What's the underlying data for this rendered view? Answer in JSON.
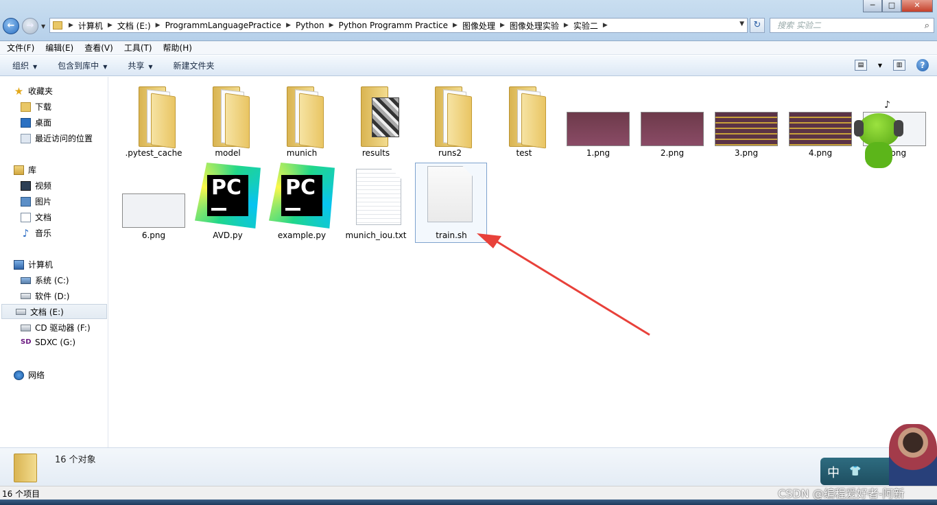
{
  "window": {
    "minimize_label": "─",
    "maximize_label": "□",
    "close_label": "✕"
  },
  "address": {
    "breadcrumbs": [
      "计算机",
      "文档 (E:)",
      "ProgrammLanguagePractice",
      "Python",
      "Python Programm Practice",
      "图像处理",
      "图像处理实验",
      "实验二"
    ]
  },
  "search": {
    "placeholder": "搜索 实验二"
  },
  "menu": [
    "文件(F)",
    "编辑(E)",
    "查看(V)",
    "工具(T)",
    "帮助(H)"
  ],
  "toolbar": [
    "组织",
    "包含到库中",
    "共享",
    "新建文件夹"
  ],
  "nav": {
    "favorites": "收藏夹",
    "downloads": "下载",
    "desktop": "桌面",
    "recent": "最近访问的位置",
    "libraries": "库",
    "videos": "视频",
    "pictures": "图片",
    "documents": "文档",
    "music": "音乐",
    "computer": "计算机",
    "drive_c": "系统 (C:)",
    "drive_d": "软件 (D:)",
    "drive_e": "文档 (E:)",
    "drive_f": "CD 驱动器 (F:)",
    "drive_g": "SDXC (G:)",
    "network": "网络"
  },
  "files": [
    ".pytest_cache",
    "model",
    "munich",
    "results",
    "runs2",
    "test",
    "1.png",
    "2.png",
    "3.png",
    "4.png",
    "5.png",
    "6.png",
    "AVD.py",
    "example.py",
    "munich_iou.txt",
    "train.sh"
  ],
  "details": {
    "count": "16 个对象"
  },
  "status": {
    "items": "16 个项目"
  },
  "overlay": {
    "ime": "中",
    "watermark": "CSDN @编程爱好者-阿新"
  }
}
